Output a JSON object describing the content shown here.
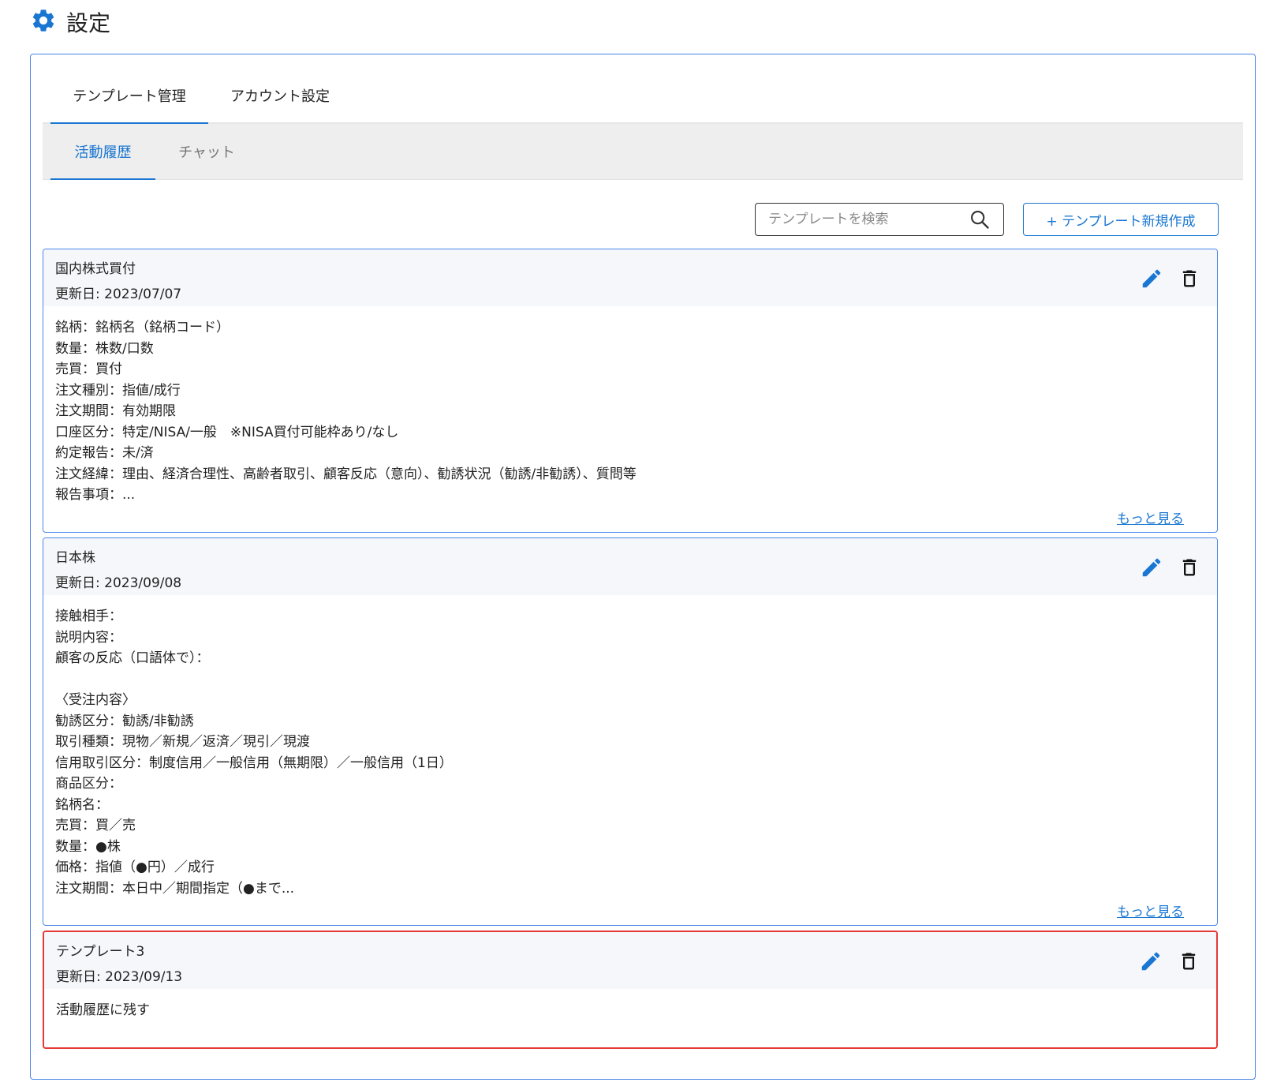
{
  "page": {
    "title": "設定",
    "icon": "gear-icon"
  },
  "main_tabs": [
    {
      "label": "テンプレート管理",
      "active": true
    },
    {
      "label": "アカウント設定",
      "active": false
    }
  ],
  "sub_tabs": [
    {
      "label": "活動履歴",
      "active": true
    },
    {
      "label": "チャット",
      "active": false
    }
  ],
  "toolbar": {
    "search_placeholder": "テンプレートを検索",
    "search_icon": "search-icon",
    "new_button_label": "+ テンプレート新規作成"
  },
  "templates": [
    {
      "title": "国内株式買付",
      "updated": "更新日: 2023/07/07",
      "body": "銘柄：銘柄名（銘柄コード）\n数量：株数/口数\n売買：買付\n注文種別：指値/成行\n注文期間：有効期限\n口座区分：特定/NISA/一般　※NISA買付可能枠あり/なし\n約定報告：未/済\n注文経緯：理由、経済合理性、高齢者取引、顧客反応（意向）、勧誘状況（勧誘/非勧誘）、質問等\n報告事項：...",
      "more_label": "もっと見る"
    },
    {
      "title": "日本株",
      "updated": "更新日: 2023/09/08",
      "body": "接触相手：\n説明内容：\n顧客の反応（口語体で）：\n\n〈受注内容〉\n勧誘区分：勧誘/非勧誘\n取引種類：現物／新規／返済／現引／現渡\n信用取引区分：制度信用／一般信用（無期限）／一般信用（1日）\n商品区分：\n銘柄名：\n売買：買／売\n数量：●株\n価格：指値（●円）／成行\n注文期間：本日中／期間指定（●まで...",
      "more_label": "もっと見る"
    },
    {
      "title": "テンプレート3",
      "updated": "更新日: 2023/09/13",
      "body": "活動履歴に残す"
    }
  ],
  "colors": {
    "accent": "#1976d2",
    "card_border": "#4a86e8",
    "highlight_border": "#e53935"
  }
}
